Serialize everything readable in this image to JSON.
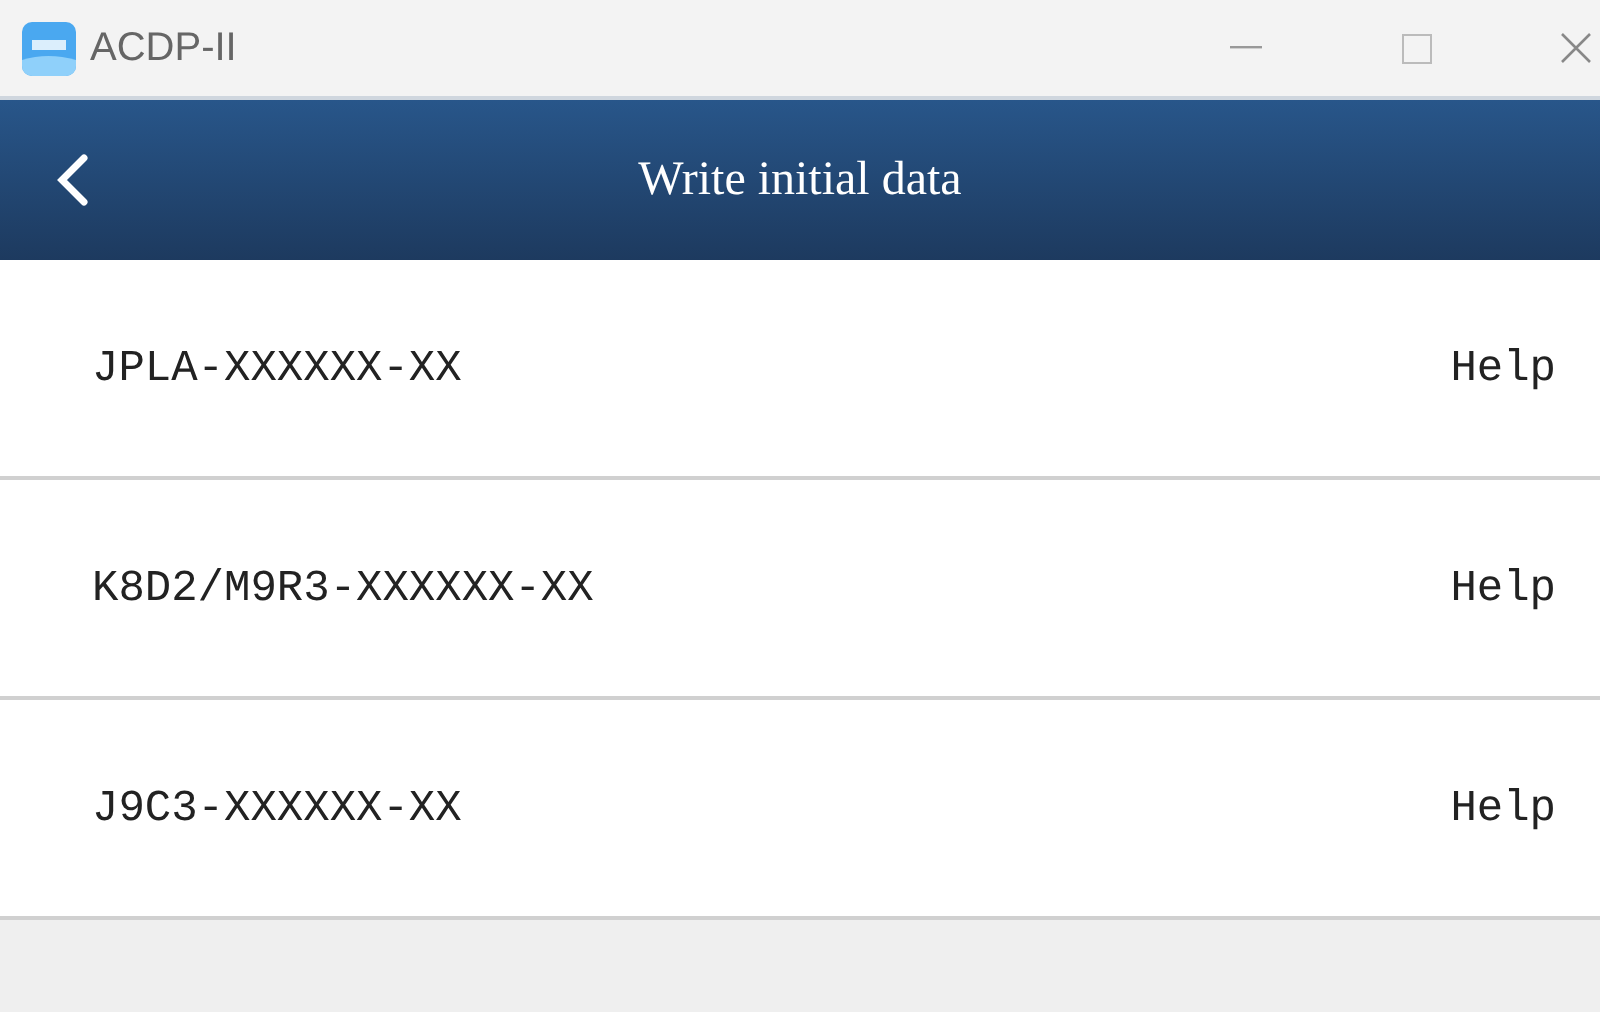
{
  "window": {
    "title": "ACDP-II"
  },
  "header": {
    "title": "Write initial data"
  },
  "items": [
    {
      "label": "JPLA-XXXXXX-XX",
      "help": "Help"
    },
    {
      "label": "K8D2/M9R3-XXXXXX-XX",
      "help": "Help"
    },
    {
      "label": "J9C3-XXXXXX-XX",
      "help": "Help"
    }
  ]
}
